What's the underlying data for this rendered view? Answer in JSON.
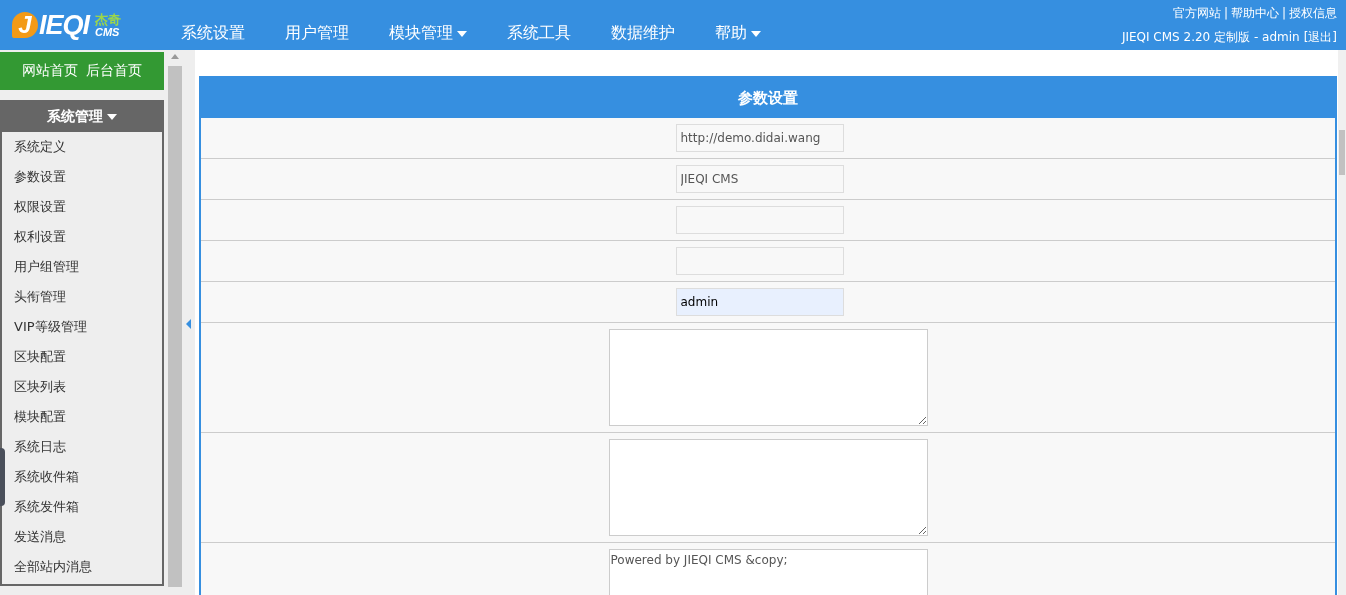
{
  "logo": {
    "mark": "J",
    "name": "IEQI",
    "cn": "杰奇",
    "sub": "CMS"
  },
  "nav": [
    {
      "label": "系统设置",
      "dropdown": false
    },
    {
      "label": "用户管理",
      "dropdown": false
    },
    {
      "label": "模块管理",
      "dropdown": true
    },
    {
      "label": "系统工具",
      "dropdown": false
    },
    {
      "label": "数据维护",
      "dropdown": false
    },
    {
      "label": "帮助",
      "dropdown": true
    }
  ],
  "top_links": {
    "links": [
      "官方网站",
      "帮助中心",
      "授权信息"
    ],
    "separator": "|"
  },
  "user_info": {
    "text": "JIEQI CMS 2.20 定制版 - admin",
    "logout": "[退出]"
  },
  "sidebar": {
    "home_links": [
      "网站首页",
      "后台首页"
    ],
    "section": {
      "title": "系统管理",
      "expanded": true
    },
    "items": [
      "系统定义",
      "参数设置",
      "权限设置",
      "权利设置",
      "用户组管理",
      "头衔管理",
      "VIP等级管理",
      "区块配置",
      "区块列表",
      "模块配置",
      "系统日志",
      "系统收件箱",
      "系统发件箱",
      "发送消息",
      "全部站内消息"
    ]
  },
  "panel": {
    "title": "参数设置",
    "rows": [
      {
        "kind": "input",
        "value": "http://demo.didai.wang",
        "autofilled": false
      },
      {
        "kind": "input",
        "value": "JIEQI CMS",
        "autofilled": false
      },
      {
        "kind": "input",
        "autofilled": false
      },
      {
        "kind": "input",
        "autofilled": false
      },
      {
        "kind": "input",
        "value": "admin",
        "autofilled": true
      },
      {
        "kind": "textarea"
      },
      {
        "kind": "textarea"
      },
      {
        "kind": "textarea",
        "value": "Powered by JIEQI CMS &copy;"
      }
    ]
  }
}
